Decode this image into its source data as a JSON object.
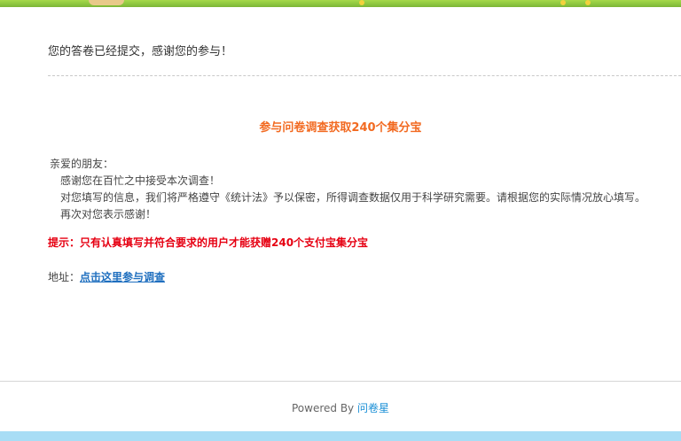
{
  "banner": {
    "colors": {
      "grass": "#8cc63f",
      "flower": "#f3d23c"
    }
  },
  "status": {
    "submitted_text": "您的答卷已经提交，感谢您的参与！"
  },
  "promo": {
    "title": "参与问卷调查获取240个集分宝",
    "color": "#f26a21"
  },
  "letter": {
    "greeting": "亲爱的朋友：",
    "lines": [
      "感谢您在百忙之中接受本次调查！",
      "对您填写的信息，我们将严格遵守《统计法》予以保密，所得调查数据仅用于科学研究需要。请根据您的实际情况放心填写。",
      "再次对您表示感谢！"
    ]
  },
  "tip": {
    "text": "提示：只有认真填写并符合要求的用户才能获赠240个支付宝集分宝",
    "color": "#e60012"
  },
  "address": {
    "label": "地址：",
    "link_text": "点击这里参与调查"
  },
  "footer": {
    "powered_by": "Powered By",
    "brand": "问卷星"
  },
  "bottom_bar": {
    "color": "#a8ddf5"
  }
}
